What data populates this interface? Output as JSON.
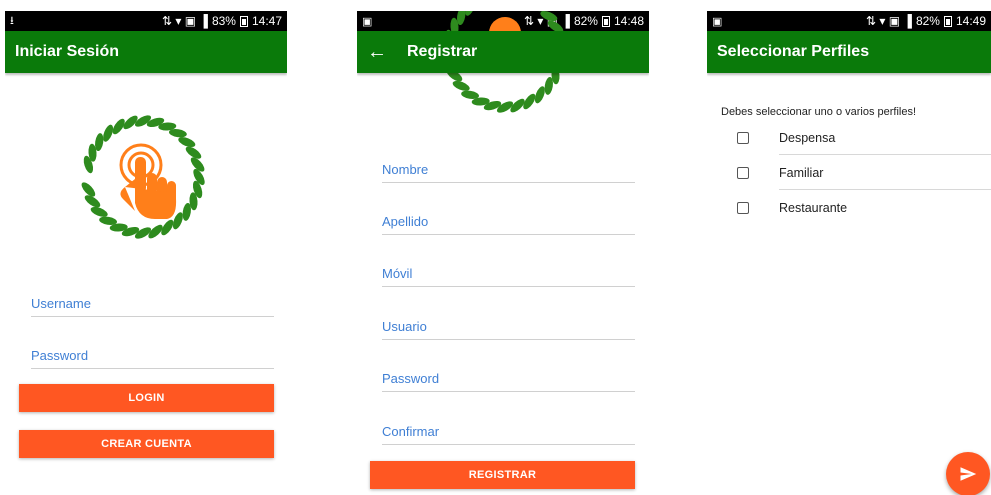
{
  "screens": {
    "login": {
      "status": {
        "left_icon": "download-icon",
        "icons": "✕• ▾ ▣ ᴴ .│",
        "battery": "83%",
        "time": "14:47"
      },
      "title": "Iniciar Sesión",
      "logo_icon": "tap-hand-laurel-logo-icon",
      "fields": {
        "username": "Username",
        "password": "Password"
      },
      "buttons": {
        "login": "LOGIN",
        "create": "CREAR CUENTA"
      }
    },
    "register": {
      "status": {
        "left_icon": "image-icon",
        "icons": "✕• ▾ ▣ ᴴ .│",
        "battery": "82%",
        "time": "14:48"
      },
      "title": "Registrar",
      "back_icon": "arrow-back-icon",
      "fields": {
        "nombre": "Nombre",
        "apellido": "Apellido",
        "movil": "Móvil",
        "usuario": "Usuario",
        "password": "Password",
        "confirmar": "Confirmar"
      },
      "buttons": {
        "register": "REGISTRAR"
      }
    },
    "profiles": {
      "status": {
        "left_icon": "image-icon",
        "icons": "✕• ▾ ▣ ᴴ .│",
        "battery": "82%",
        "time": "14:49"
      },
      "title": "Seleccionar Perfiles",
      "intro": "Debes seleccionar uno o varios perfiles!",
      "options": [
        "Despensa",
        "Familiar",
        "Restaurante"
      ],
      "fab_icon": "send-icon"
    }
  },
  "colors": {
    "appbar": "#0a7a0a",
    "accent": "#ff5722",
    "hint": "#3f7fd4",
    "logo_green": "#2e8b1e",
    "logo_orange": "#ff7f1a"
  }
}
